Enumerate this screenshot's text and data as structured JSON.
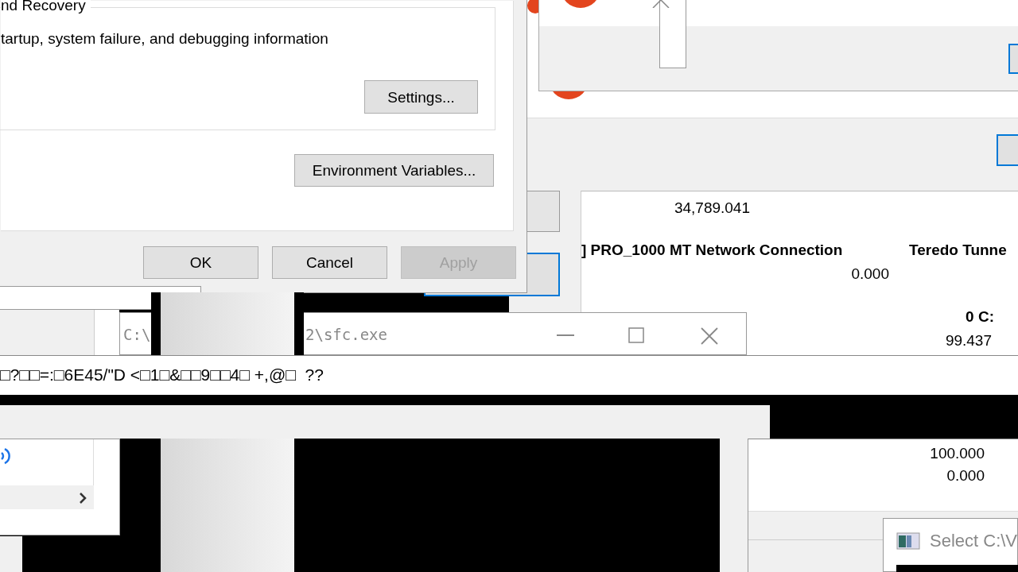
{
  "system_properties": {
    "group_title": "nd Recovery",
    "group_text": "tartup, system failure, and debugging information",
    "settings_button": "Settings...",
    "env_button": "Environment Variables...",
    "buttons": [
      {
        "label": "OK",
        "disabled": false
      },
      {
        "label": "Cancel",
        "disabled": false
      },
      {
        "label": "Apply",
        "disabled": true
      }
    ]
  },
  "perf_monitor": {
    "items": [
      {
        "text": "34,789.041",
        "bold": false
      },
      {
        "text": "] PRO_1000 MT Network Connection",
        "bold": true
      },
      {
        "text": "Teredo Tunne",
        "bold": true
      },
      {
        "text": "0.000",
        "bold": false
      },
      {
        "text": "0 C:",
        "bold": true
      },
      {
        "text": "99.437",
        "bold": false
      }
    ]
  },
  "console": {
    "title_left": "C:\\",
    "title_right": "2\\sfc.exe",
    "output": "□?□□=:□6E45/\"D <□1□&□□9□□4□ +,@□  ??"
  },
  "readings": [
    "100.000",
    "0.000"
  ],
  "select_window": {
    "title": "Select C:\\V"
  }
}
